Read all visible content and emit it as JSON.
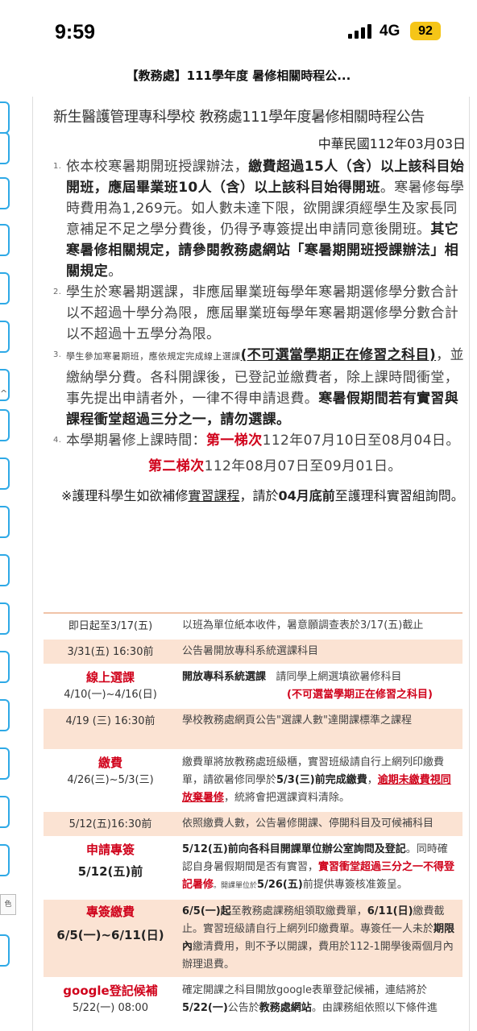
{
  "status_bar": {
    "time": "9:59",
    "network": "4G",
    "battery": "92"
  },
  "page_title": "【教務處】111學年度 暑修相關時程公...",
  "sidebar": {
    "side_glyph": "^",
    "side_label": "色"
  },
  "announcement": {
    "heading": "新生醫護管理專科學校  教務處111學年度暑修相關時程公告",
    "date": "中華民國112年03月03日",
    "items": [
      {
        "num": "1.",
        "t1": "依本校寒暑期開班授課辦法，",
        "b1": "繳費超過15人（含）以上該科目始開班，應屆畢業班10人（含）以上該科目始得開班",
        "t2": "。寒暑修每學時費用為1,269元。如人數未達下限，欲開課須經學生及家長同意補足不足之學分費後，仍得予專簽提出申請同意後開班。",
        "b2": "其它寒暑修相關規定，請參閱教務處網站「寒暑期開班授課辦法」相關規定",
        "t3": "。"
      },
      {
        "num": "2.",
        "t1": "學生於寒暑期選課，非應屆畢業班每學年寒暑期選修學分數合計以不超過十學分為限，應屆畢業班每學年寒暑期選修學分數合計以不超過十五學分為限。"
      },
      {
        "num": "3.",
        "s1": "學生參加寒暑期班，應依規定完成線上選課",
        "u1": "(不可選當學期正在修習之科目)",
        "t1": "，並繳納學分費。各科開課後，已登記並繳費者，除上課時間衝堂，事先提出申請者外，一律不得申請退費。",
        "b1": "寒暑假期間若有實習與課程衝堂超過三分之一，請勿選課。"
      },
      {
        "num": "4.",
        "t1": "本學期暑修上課時間：",
        "r1": "第一梯次",
        "t2": "112年07月10日至08月04日。",
        "r2": "第二梯次",
        "t3": "112年08月07日至09月01日。"
      }
    ],
    "note": {
      "t1": "※護理科學生如欲補修",
      "u1": "實習課程",
      "t2": "，請於",
      "b1": "04月底前",
      "t3": "至護理科實習組詢問。"
    }
  },
  "schedule": {
    "rows": [
      {
        "c1": "即日起至3/17(五)",
        "c2": "以班為單位紙本收件，暑意願調查表於3/17(五)截止"
      },
      {
        "c1": "3/31(五) 16:30前",
        "c2": "公告暑開放專科系統選課科目"
      },
      {
        "label": "線上選課",
        "c1": "4/10(一)~4/16(日)",
        "c2a": "開放專科系統選課",
        "c2b": "請同學上網選填欲暑修科目",
        "c2c": "(不可選當學期正在修習之科目)"
      },
      {
        "c1": "4/19 (三) 16:30前",
        "c2": "學校教務處網頁公告\"選課人數\"達開課標準之課程"
      },
      {
        "label": "繳費",
        "c1": "4/26(三)~5/3(三)",
        "c2a": "繳費單將放教務處班級櫃，實習班級請自行上網列印繳費單，請欲暑修同學於",
        "c2b": "5/3(三)前完成繳費",
        "c2c": "，",
        "c2d": "逾期未繳費視同放棄暑修",
        "c2e": "，統將會把選課資料清除。"
      },
      {
        "c1": "5/12(五)16:30前",
        "c2": "依照繳費人數，公告暑修開課、停開科目及可候補科目"
      },
      {
        "label": "申請專簽",
        "c1": "5/12(五)前",
        "c2a": "5/12(五)前向各科目開課單位辦公室詢問及登記",
        "c2b": "。同時確認自身暑假期間是否有實習，",
        "c2c": "實習衝堂超過三分之一不得登記暑修",
        "c2d": "。開課單位於",
        "c2e": "5/26(五)",
        "c2f": "前提供專簽核准簽呈。"
      },
      {
        "label": "專簽繳費",
        "c1": "6/5(一)~6/11(日)",
        "c2a": "6/5(一)起",
        "c2b": "至教務處課務組領取繳費單，",
        "c2c": "6/11(日)",
        "c2d": "繳費截止。實習班級請自行上網列印繳費單。專簽任一人未於",
        "c2e": "期限內",
        "c2f": "繳清費用，則不予以開課，費用於112-1開學後兩個月內辦理退費。"
      },
      {
        "label": "google登記候補",
        "c1": "5/22(一) 08:00",
        "c2a": "確定開課之科目開放google表單登記候補，連結將於",
        "c2b": "5/22(一)",
        "c2c": "公告於",
        "c2d": "教務處網站",
        "c2e": "。由課務組依照以下條件進"
      }
    ]
  },
  "colors": {
    "accent_red": "#d0021b",
    "row_peach": "#fbe3d3",
    "tab_blue": "#2ea9e6",
    "battery_yellow": "#f5c518"
  }
}
